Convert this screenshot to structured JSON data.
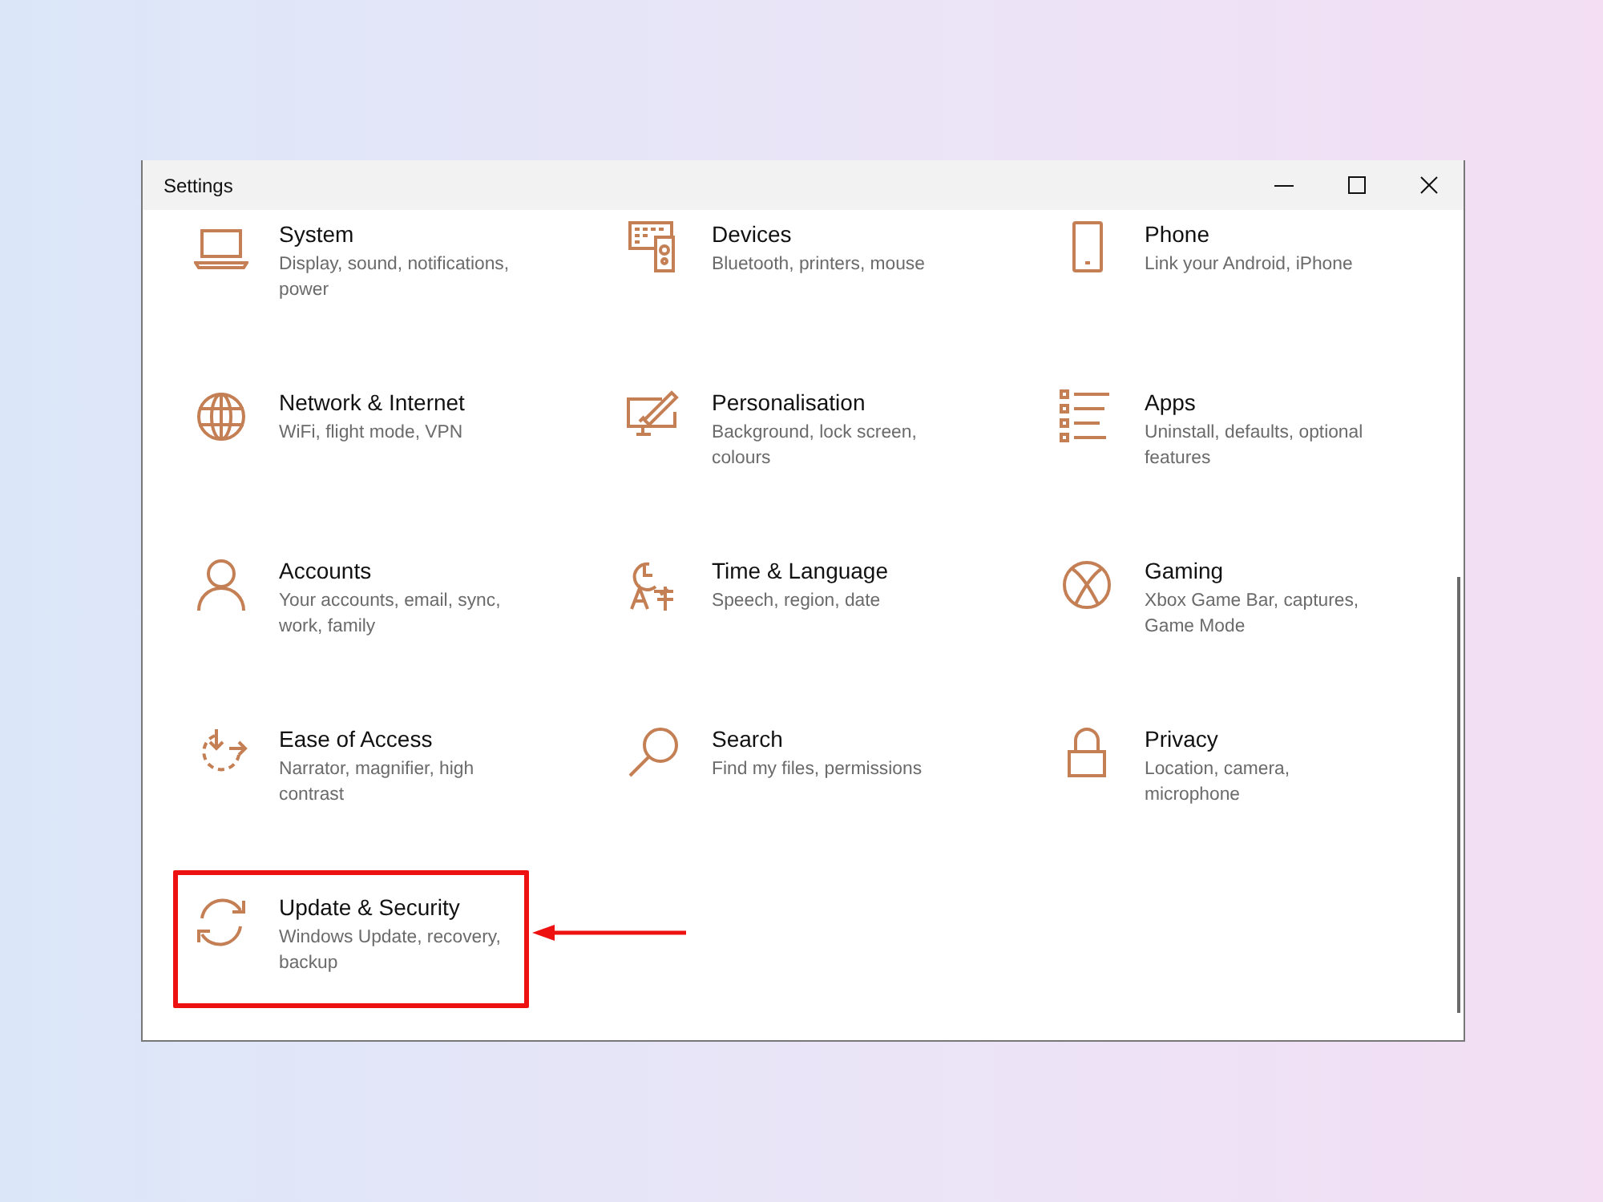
{
  "window": {
    "title": "Settings"
  },
  "items": [
    {
      "title": "System",
      "description": "Display, sound, notifications, power",
      "highlighted": false
    },
    {
      "title": "Devices",
      "description": "Bluetooth, printers, mouse",
      "highlighted": false
    },
    {
      "title": "Phone",
      "description": "Link your Android, iPhone",
      "highlighted": false
    },
    {
      "title": "Network & Internet",
      "description": "WiFi, flight mode, VPN",
      "highlighted": false
    },
    {
      "title": "Personalisation",
      "description": "Background, lock screen, colours",
      "highlighted": false
    },
    {
      "title": "Apps",
      "description": "Uninstall, defaults, optional features",
      "highlighted": false
    },
    {
      "title": "Accounts",
      "description": "Your accounts, email, sync, work, family",
      "highlighted": false
    },
    {
      "title": "Time & Language",
      "description": "Speech, region, date",
      "highlighted": false
    },
    {
      "title": "Gaming",
      "description": "Xbox Game Bar, captures, Game Mode",
      "highlighted": false
    },
    {
      "title": "Ease of Access",
      "description": "Narrator, magnifier, high contrast",
      "highlighted": false
    },
    {
      "title": "Search",
      "description": "Find my files, permissions",
      "highlighted": false
    },
    {
      "title": "Privacy",
      "description": "Location, camera, microphone",
      "highlighted": false
    },
    {
      "title": "Update & Security",
      "description": "Windows Update, recovery, backup",
      "highlighted": true
    }
  ]
}
